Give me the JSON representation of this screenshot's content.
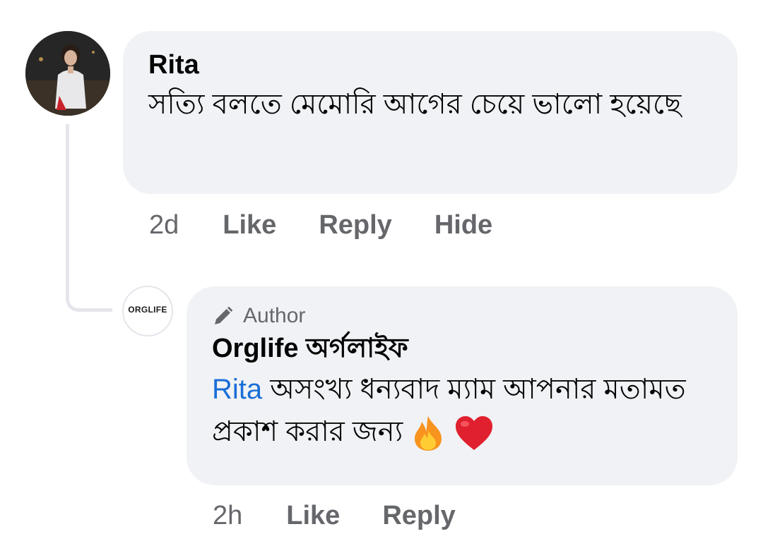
{
  "comments": [
    {
      "author": "Rita",
      "text": "সত্যি বলতে মেমোরি আগের চেয়ে ভালো হয়েছে",
      "time": "2d",
      "actions": {
        "like": "Like",
        "reply": "Reply",
        "hide": "Hide"
      }
    }
  ],
  "reply": {
    "badge": "Author",
    "author": "Orglife অর্গলাইফ",
    "mention": "Rita",
    "text": "অসংখ্য ধন্যবাদ ম্যাম আপনার মতামত প্রকাশ করার জন্য",
    "emojis": [
      "fire-emoji",
      "red-heart-emoji"
    ],
    "time": "2h",
    "actions": {
      "like": "Like",
      "reply": "Reply"
    },
    "avatar_logo": "ORGLIFE"
  },
  "colors": {
    "bubble": "#f0f2f5",
    "meta": "#65676b",
    "mention": "#1a6ed8",
    "thread_line": "#e4e6eb"
  }
}
